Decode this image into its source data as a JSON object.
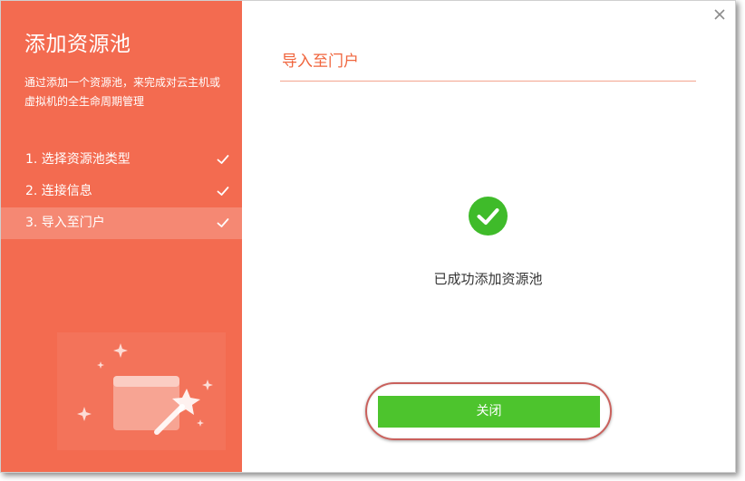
{
  "sidebar": {
    "title": "添加资源池",
    "description": "通过添加一个资源池，来完成对云主机或虚拟机的全生命周期管理",
    "steps": [
      {
        "label": "1. 选择资源池类型",
        "done": true
      },
      {
        "label": "2. 连接信息",
        "done": true
      },
      {
        "label": "3. 导入至门户",
        "done": true,
        "active": true
      }
    ],
    "illustration": "magic-wand-window-illustration"
  },
  "content": {
    "title": "导入至门户",
    "success_message": "已成功添加资源池",
    "close_button_label": "关闭"
  },
  "colors": {
    "sidebar_bg": "#f36b50",
    "accent": "#f0643c",
    "success_green": "#4dc42d",
    "highlight_ring": "#c9605c"
  },
  "icons": [
    "check-icon",
    "close-x-icon",
    "success-check-circle-icon",
    "magic-wand-icon",
    "sparkle-icon"
  ]
}
